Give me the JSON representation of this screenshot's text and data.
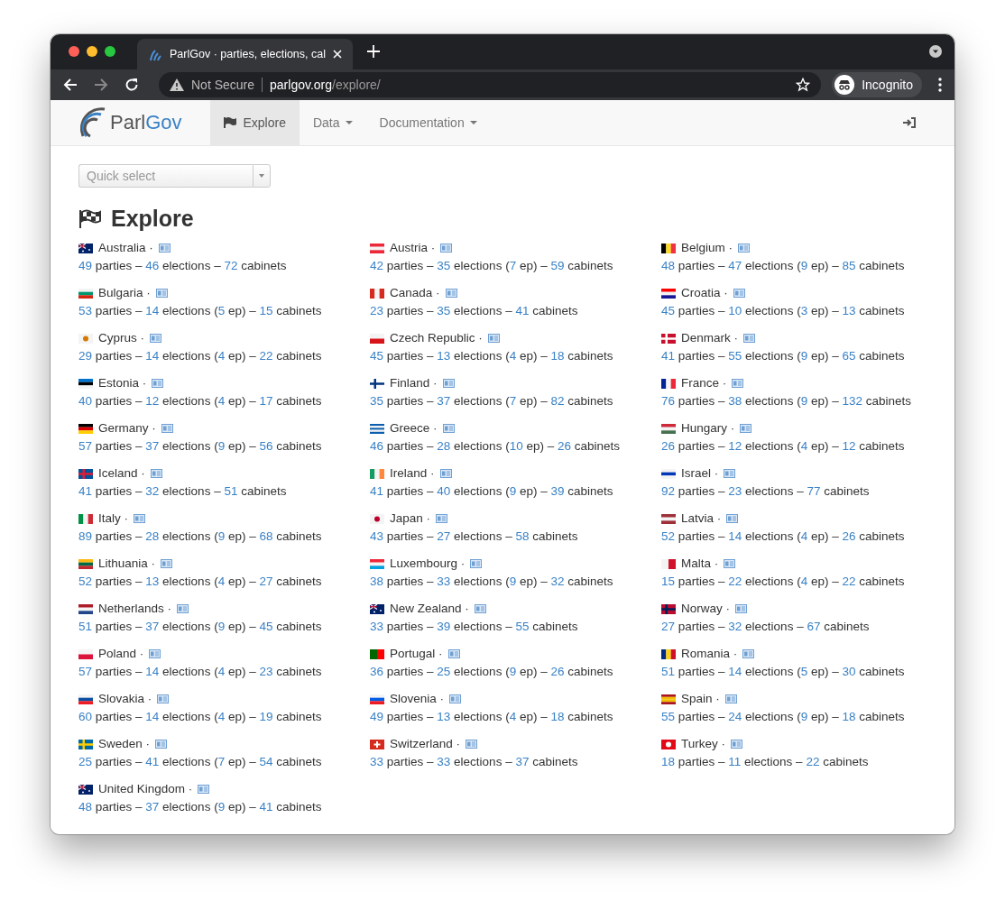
{
  "browser": {
    "tab": {
      "title": "ParlGov · parties, elections, cal",
      "selected": true
    },
    "security": "Not Secure",
    "url_host": "parlgov.org",
    "url_path": "/explore/",
    "profile": "Incognito"
  },
  "navbar": {
    "logo_a": "Parl",
    "logo_b": "Gov",
    "items": [
      {
        "label": "Explore",
        "selected": true,
        "dropdown": false
      },
      {
        "label": "Data",
        "selected": false,
        "dropdown": true
      },
      {
        "label": "Documentation",
        "selected": false,
        "dropdown": true
      }
    ]
  },
  "quick_select": {
    "placeholder": "Quick select"
  },
  "heading": "Explore",
  "countries": [
    {
      "name": "Australia ·",
      "stats": [
        "49",
        " parties – ",
        "46",
        " elections – ",
        "72",
        " cabinets"
      ]
    },
    {
      "name": "Austria ·",
      "stats": [
        "42",
        " parties – ",
        "35",
        " elections (",
        "7",
        " ep) – ",
        "59",
        " cabinets"
      ]
    },
    {
      "name": "Belgium ·",
      "stats": [
        "48",
        " parties – ",
        "47",
        " elections (",
        "9",
        " ep) – ",
        "85",
        " cabinets"
      ]
    },
    {
      "name": "Bulgaria ·",
      "stats": [
        "53",
        " parties – ",
        "14",
        " elections (",
        "5",
        " ep) – ",
        "15",
        " cabinets"
      ]
    },
    {
      "name": "Canada ·",
      "stats": [
        "23",
        " parties – ",
        "35",
        " elections – ",
        "41",
        " cabinets"
      ]
    },
    {
      "name": "Croatia ·",
      "stats": [
        "45",
        " parties – ",
        "10",
        " elections (",
        "3",
        " ep) – ",
        "13",
        " cabinets"
      ]
    },
    {
      "name": "Cyprus ·",
      "stats": [
        "29",
        " parties – ",
        "14",
        " elections (",
        "4",
        " ep) – ",
        "22",
        " cabinets"
      ]
    },
    {
      "name": "Czech Republic ·",
      "stats": [
        "45",
        " parties – ",
        "13",
        " elections (",
        "4",
        " ep) – ",
        "18",
        " cabinets"
      ]
    },
    {
      "name": "Denmark ·",
      "stats": [
        "41",
        " parties – ",
        "55",
        " elections (",
        "9",
        " ep) – ",
        "65",
        " cabinets"
      ]
    },
    {
      "name": "Estonia ·",
      "stats": [
        "40",
        " parties – ",
        "12",
        " elections (",
        "4",
        " ep) – ",
        "17",
        " cabinets"
      ]
    },
    {
      "name": "Finland ·",
      "stats": [
        "35",
        " parties – ",
        "37",
        " elections (",
        "7",
        " ep) – ",
        "82",
        " cabinets"
      ]
    },
    {
      "name": "France ·",
      "stats": [
        "76",
        " parties – ",
        "38",
        " elections (",
        "9",
        " ep) – ",
        "132",
        " cabinets"
      ]
    },
    {
      "name": "Germany ·",
      "stats": [
        "57",
        " parties – ",
        "37",
        " elections (",
        "9",
        " ep) – ",
        "56",
        " cabinets"
      ]
    },
    {
      "name": "Greece ·",
      "stats": [
        "46",
        " parties – ",
        "28",
        " elections (",
        "10",
        " ep) – ",
        "26",
        " cabinets"
      ]
    },
    {
      "name": "Hungary ·",
      "stats": [
        "26",
        " parties – ",
        "12",
        " elections (",
        "4",
        " ep) – ",
        "12",
        " cabinets"
      ]
    },
    {
      "name": "Iceland ·",
      "stats": [
        "41",
        " parties – ",
        "32",
        " elections – ",
        "51",
        " cabinets"
      ]
    },
    {
      "name": "Ireland ·",
      "stats": [
        "41",
        " parties – ",
        "40",
        " elections (",
        "9",
        " ep) – ",
        "39",
        " cabinets"
      ]
    },
    {
      "name": "Israel ·",
      "stats": [
        "92",
        " parties – ",
        "23",
        " elections – ",
        "77",
        " cabinets"
      ]
    },
    {
      "name": "Italy ·",
      "stats": [
        "89",
        " parties – ",
        "28",
        " elections (",
        "9",
        " ep) – ",
        "68",
        " cabinets"
      ]
    },
    {
      "name": "Japan ·",
      "stats": [
        "43",
        " parties – ",
        "27",
        " elections – ",
        "58",
        " cabinets"
      ]
    },
    {
      "name": "Latvia ·",
      "stats": [
        "52",
        " parties – ",
        "14",
        " elections (",
        "4",
        " ep) – ",
        "26",
        " cabinets"
      ]
    },
    {
      "name": "Lithuania ·",
      "stats": [
        "52",
        " parties – ",
        "13",
        " elections (",
        "4",
        " ep) – ",
        "27",
        " cabinets"
      ]
    },
    {
      "name": "Luxembourg ·",
      "stats": [
        "38",
        " parties – ",
        "33",
        " elections (",
        "9",
        " ep) – ",
        "32",
        " cabinets"
      ]
    },
    {
      "name": "Malta ·",
      "stats": [
        "15",
        " parties – ",
        "22",
        " elections (",
        "4",
        " ep) – ",
        "22",
        " cabinets"
      ]
    },
    {
      "name": "Netherlands ·",
      "stats": [
        "51",
        " parties – ",
        "37",
        " elections (",
        "9",
        " ep) – ",
        "45",
        " cabinets"
      ]
    },
    {
      "name": "New Zealand ·",
      "stats": [
        "33",
        " parties – ",
        "39",
        " elections – ",
        "55",
        " cabinets"
      ]
    },
    {
      "name": "Norway ·",
      "stats": [
        "27",
        " parties – ",
        "32",
        " elections – ",
        "67",
        " cabinets"
      ]
    },
    {
      "name": "Poland ·",
      "stats": [
        "57",
        " parties – ",
        "14",
        " elections (",
        "4",
        " ep) – ",
        "23",
        " cabinets"
      ]
    },
    {
      "name": "Portugal ·",
      "stats": [
        "36",
        " parties – ",
        "25",
        " elections (",
        "9",
        " ep) – ",
        "26",
        " cabinets"
      ]
    },
    {
      "name": "Romania ·",
      "stats": [
        "51",
        " parties – ",
        "14",
        " elections (",
        "5",
        " ep) – ",
        "30",
        " cabinets"
      ]
    },
    {
      "name": "Slovakia ·",
      "stats": [
        "60",
        " parties – ",
        "14",
        " elections (",
        "4",
        " ep) – ",
        "19",
        " cabinets"
      ]
    },
    {
      "name": "Slovenia ·",
      "stats": [
        "49",
        " parties – ",
        "13",
        " elections (",
        "4",
        " ep) – ",
        "18",
        " cabinets"
      ]
    },
    {
      "name": "Spain ·",
      "stats": [
        "55",
        " parties – ",
        "24",
        " elections (",
        "9",
        " ep) – ",
        "18",
        " cabinets"
      ]
    },
    {
      "name": "Sweden ·",
      "stats": [
        "25",
        " parties – ",
        "41",
        " elections (",
        "7",
        " ep) – ",
        "54",
        " cabinets"
      ]
    },
    {
      "name": "Switzerland ·",
      "stats": [
        "33",
        " parties – ",
        "33",
        " elections – ",
        "37",
        " cabinets"
      ]
    },
    {
      "name": "Turkey ·",
      "stats": [
        "18",
        " parties – ",
        "11",
        " elections – ",
        "22",
        " cabinets"
      ]
    },
    {
      "name": "United Kingdom ·",
      "stats": [
        "48",
        " parties – ",
        "37",
        " elections (",
        "9",
        " ep) – ",
        "41",
        " cabinets"
      ]
    }
  ]
}
